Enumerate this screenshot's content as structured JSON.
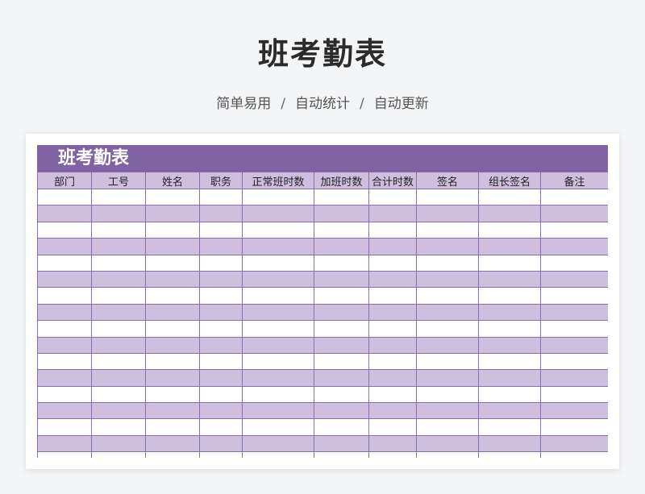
{
  "header": {
    "title": "班考勤表",
    "subtitle_parts": [
      "简单易用",
      "自动统计",
      "自动更新"
    ],
    "separator": "/"
  },
  "sheet": {
    "title": "班考勤表",
    "columns": [
      "部门",
      "工号",
      "姓名",
      "职务",
      "正常班时数",
      "加班时数",
      "合计时数",
      "签名",
      "组长签名",
      "备注"
    ],
    "row_count": 17
  },
  "colors": {
    "header_band": "#7f63a2",
    "stripe": "#cdbfdd",
    "grid_line": "#8a6fae"
  }
}
